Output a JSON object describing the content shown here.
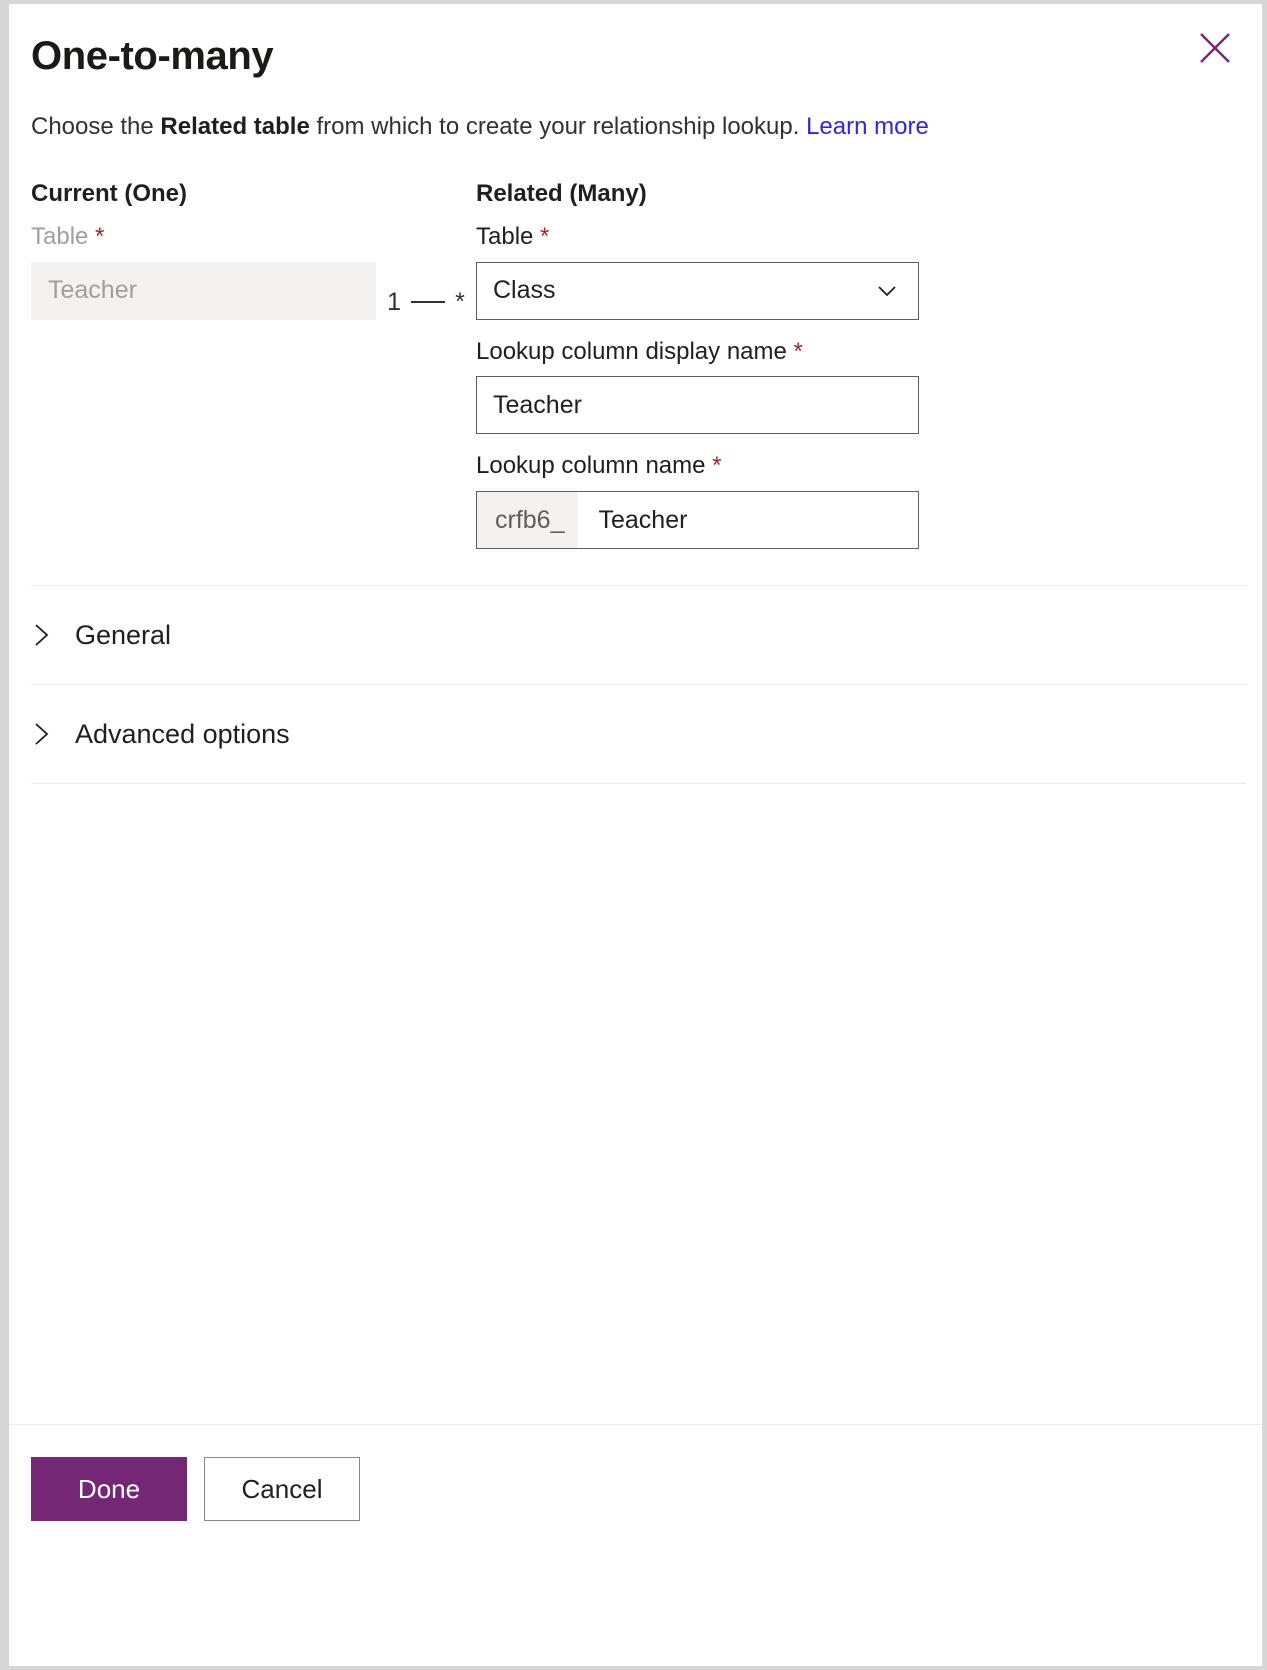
{
  "dialog": {
    "title": "One-to-many",
    "close_icon": "close-icon",
    "description": {
      "before": "Choose the ",
      "bold": "Related table",
      "after": " from which to create your relationship lookup. ",
      "link": "Learn more"
    }
  },
  "current": {
    "heading": "Current (One)",
    "table_label": "Table",
    "required_mark": "*",
    "table_value": "Teacher"
  },
  "connector": {
    "left": "1",
    "right": "*"
  },
  "related": {
    "heading": "Related (Many)",
    "table_label": "Table",
    "required_mark": "*",
    "table_value": "Class",
    "dropdown_icon": "chevron-down-icon",
    "display_name_label": "Lookup column display name",
    "display_name_value": "Teacher",
    "column_name_label": "Lookup column name",
    "column_name_prefix": "crfb6_",
    "column_name_value": "Teacher"
  },
  "sections": [
    {
      "label": "General",
      "icon": "chevron-right-icon"
    },
    {
      "label": "Advanced options",
      "icon": "chevron-right-icon"
    }
  ],
  "footer": {
    "done_label": "Done",
    "cancel_label": "Cancel"
  },
  "colors": {
    "accent": "#742774",
    "link": "#2f27e0",
    "required": "#a4262c",
    "field_border": "#605e5c",
    "readonly_bg": "#f3f2f1"
  }
}
